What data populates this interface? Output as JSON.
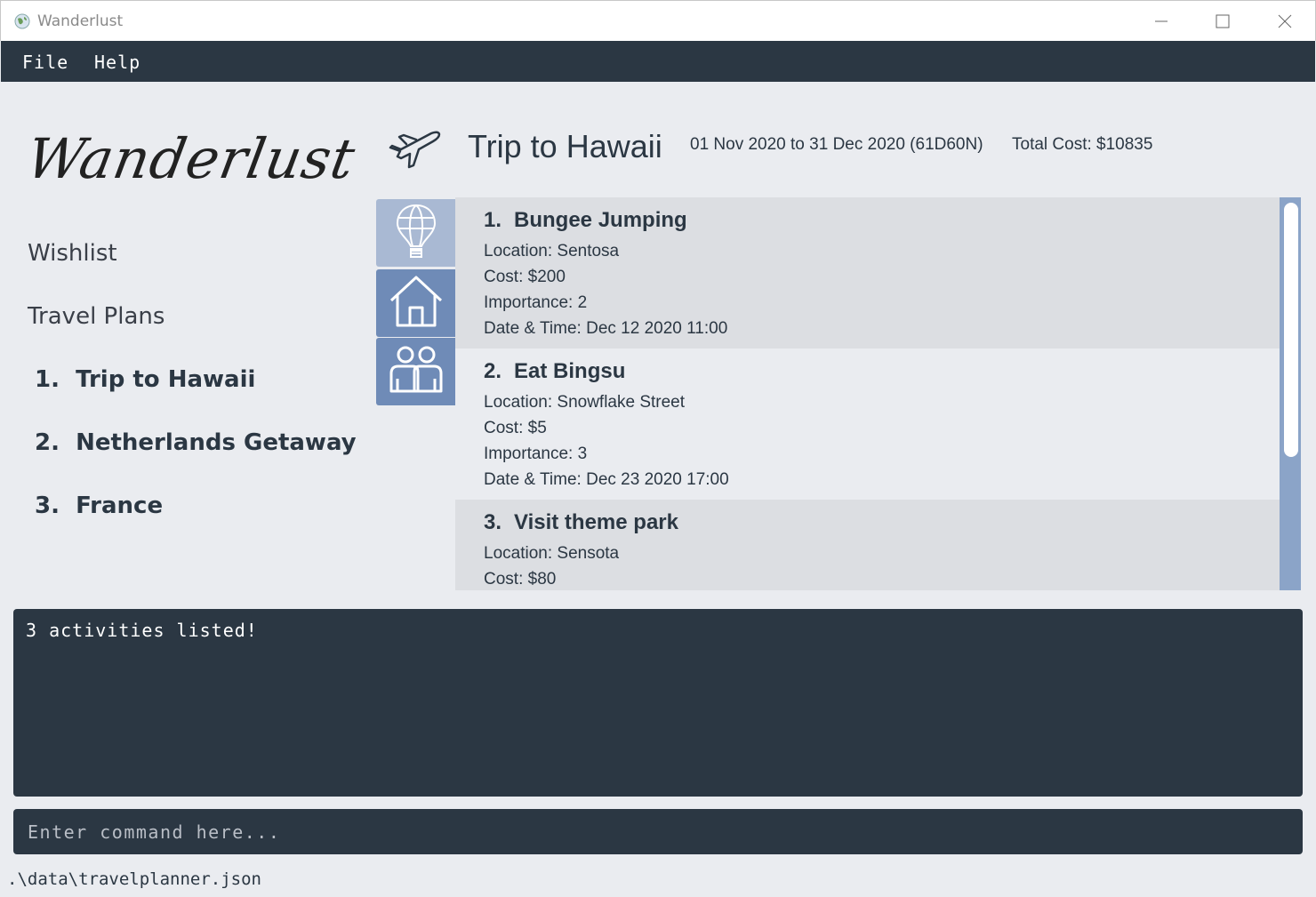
{
  "window": {
    "title": "Wanderlust",
    "icon": "globe-icon"
  },
  "menu": {
    "items": [
      "File",
      "Help"
    ]
  },
  "sidebar": {
    "logo": "Wanderlust",
    "links": [
      "Wishlist",
      "Travel Plans"
    ],
    "plans": [
      {
        "index": "1.",
        "name": "Trip to Hawaii"
      },
      {
        "index": "2.",
        "name": "Netherlands Getaway"
      },
      {
        "index": "3.",
        "name": "France"
      }
    ]
  },
  "trip": {
    "icon": "airplane-icon",
    "title": "Trip to Hawaii",
    "dates": "01 Nov 2020 to 31 Dec 2020 (61D60N)",
    "total_cost": "Total Cost: $10835"
  },
  "tabs": [
    {
      "icon": "hot-air-balloon-icon",
      "active": true
    },
    {
      "icon": "house-icon",
      "active": false
    },
    {
      "icon": "people-icon",
      "active": false
    }
  ],
  "activities": [
    {
      "index": "1.",
      "name": "Bungee Jumping",
      "location": "Location: Sentosa",
      "cost": "Cost: $200",
      "importance": "Importance: 2",
      "datetime": "Date & Time: Dec 12 2020 11:00"
    },
    {
      "index": "2.",
      "name": "Eat Bingsu",
      "location": "Location: Snowflake Street",
      "cost": "Cost: $5",
      "importance": "Importance: 3",
      "datetime": "Date & Time: Dec 23 2020 17:00"
    },
    {
      "index": "3.",
      "name": "Visit theme park",
      "location": "Location: Sensota",
      "cost": "Cost: $80",
      "importance": "",
      "datetime": ""
    }
  ],
  "result": {
    "text": "3 activities listed!"
  },
  "command": {
    "placeholder": "Enter command here...",
    "value": ""
  },
  "status": {
    "path": ".\\data\\travelplanner.json"
  },
  "colors": {
    "dark": "#2b3743",
    "background": "#eaecf0",
    "card_dark": "#dcdee2",
    "tab": "#6f8bb7",
    "tab_active": "#a9b9d3",
    "scrollbar": "#8ba4c8"
  }
}
